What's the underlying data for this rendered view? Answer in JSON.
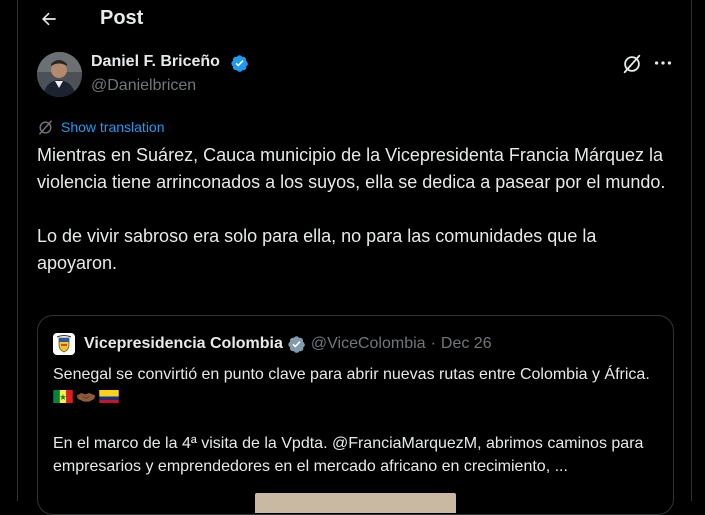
{
  "header": {
    "title": "Post"
  },
  "post": {
    "author_name": "Daniel F. Briceño",
    "author_handle": "@Danielbricen",
    "show_translation": "Show translation",
    "paragraphs": [
      "Mientras en Suárez, Cauca municipio de la Vicepresidenta Francia Márquez la violencia tiene arrinconados a los suyos, ella se dedica a pasear por el mundo.",
      "Lo de vivir sabroso era solo para ella, no para las comunidades que la apoyaron."
    ]
  },
  "quote": {
    "author_name": "Vicepresidencia Colombia",
    "author_handle": "@ViceColombia",
    "separator": "·",
    "date": "Dec 26",
    "paragraph1": "Senegal se convirtió en punto clave para abrir nuevas rutas entre Colombia y África.",
    "paragraph2": "En el marco de la 4ª visita de la Vpdta. @FranciaMarquezM, abrimos caminos para empresarios y emprendedores en el mercado africano en crecimiento, ...",
    "emoji_names": [
      "senegal-flag",
      "handshake",
      "colombia-flag"
    ]
  },
  "colors": {
    "background": "#000000",
    "text": "#e7e9ea",
    "secondary_text": "#71767b",
    "accent": "#1d9bf0",
    "border": "#2f3336",
    "gold_badge": "#e2b719"
  },
  "icons": {
    "back": "arrow-left-icon",
    "verified": "blue-verified-icon",
    "grok": "grok-icon",
    "more": "more-horizontal-icon",
    "translate": "grok-translate-icon",
    "gold_verified": "gold-verified-icon"
  }
}
